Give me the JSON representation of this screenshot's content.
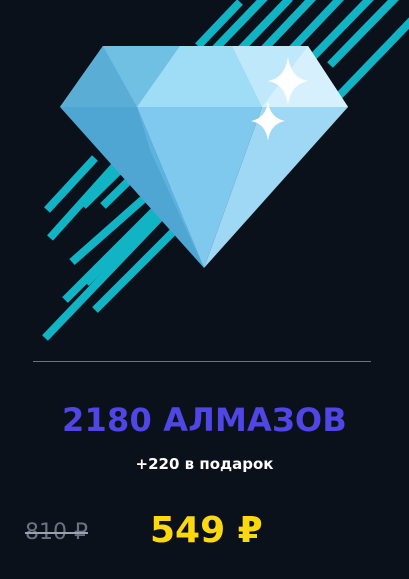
{
  "product": {
    "title": "2180 АЛМАЗОВ",
    "bonus": "+220 в подарок",
    "old_price": "810 ₽",
    "new_price": "549 ₽"
  },
  "icons": {
    "main": "diamond-icon",
    "decor": "sparkle-icon"
  },
  "colors": {
    "background": "#0b111b",
    "title": "#4f46e5",
    "price": "#fcd90f",
    "stripes": "#10b4c4",
    "diamond": "#8fd3f4"
  }
}
